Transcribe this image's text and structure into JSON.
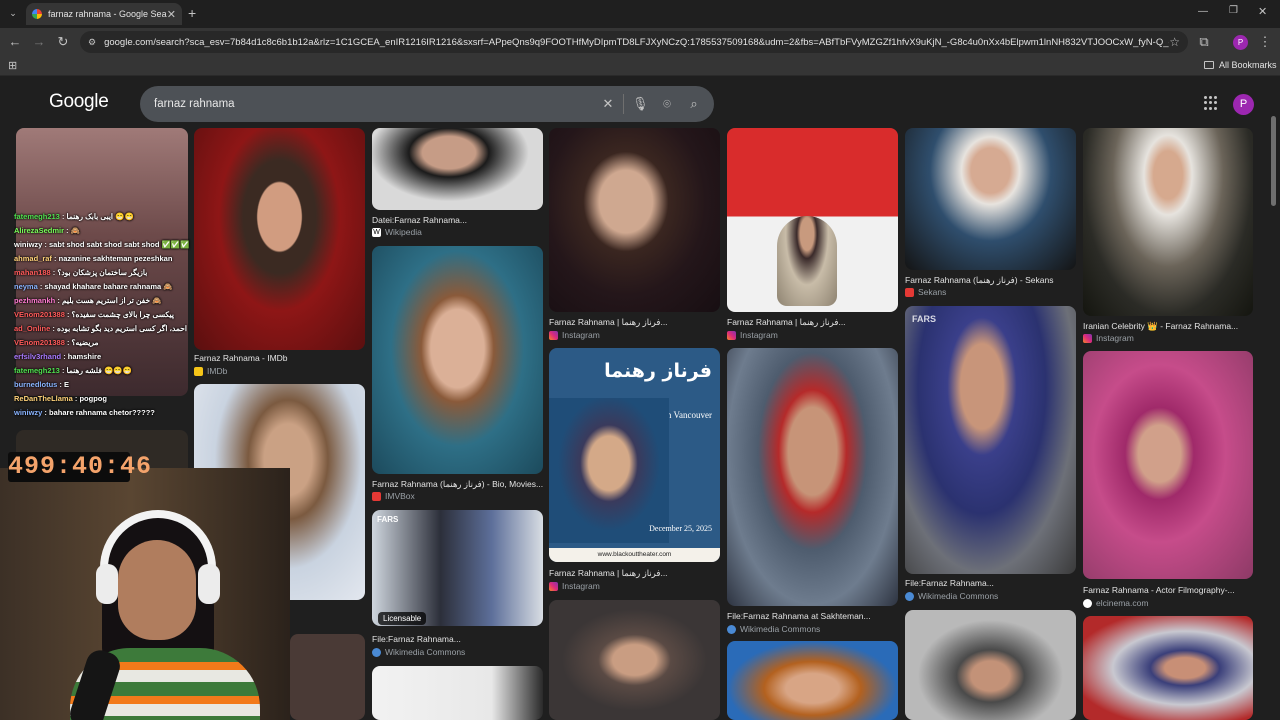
{
  "browser": {
    "tab_title": "farnaz rahnama - Google Search",
    "url": "google.com/search?sca_esv=7b84d1c8c6b1b12a&rlz=1C1GCEA_enIR1216IR1216&sxsrf=APpeQns9q9FOOTHfMyDIpmTD8LFJXyNCzQ:1785537509168&udm=2&fbs=ABfTbFVyMZGZf1hfvX9uKjN_-G8c4u0nXx4bElpwm1lnNH832VTJOOCxW_fyN-Q_ezyf8gl...",
    "bookmarks_label": "All Bookmarks",
    "profile_initial": "P"
  },
  "google": {
    "logo": "Google",
    "query": "farnaz rahnama",
    "avatar_initial": "P"
  },
  "results": [
    {
      "caption": "Datei:Farnaz Rahnama...",
      "source": "Wikipedia"
    },
    {
      "caption": "Farnaz Rahnama | فرناز رهنما...",
      "source": "Instagram"
    },
    {
      "caption": "Farnaz Rahnama | فرناز رهنما...",
      "source": "Instagram"
    },
    {
      "caption": "Farnaz Rahnama (فرناز رهنما) - Sekans",
      "source": "Sekans"
    },
    {
      "caption": "Iranian Celebrity 👑 - Farnaz Rahnama...",
      "source": "Instagram"
    },
    {
      "caption": "Farnaz Rahnama - IMDb",
      "source": "IMDb"
    },
    {
      "caption": "Farnaz Rahnama (فرناز رهنما) - Bio, Movies...",
      "source": "IMVBox"
    },
    {
      "caption": "Farnaz Rahnama | فرناز رهنما...",
      "source": "Instagram"
    },
    {
      "caption": "File:Farnaz Rahnama at Sakhteman...",
      "source": "Wikimedia Commons"
    },
    {
      "caption": "File:Farnaz Rahnama...",
      "source": "Wikimedia Commons"
    },
    {
      "caption": "Farnaz Rahnama - Actor Filmography-...",
      "source": "elcinema.com"
    },
    {
      "caption": "File:Farnaz Rahnama...",
      "source": "Wikimedia Commons"
    }
  ],
  "badges": {
    "licensable": "Licensable",
    "fars": "FARS"
  },
  "poster": {
    "title": "فرناز رهنما",
    "location": "North Vancouver",
    "date": "December 25, 2025",
    "site": "www.blackouttheater.com"
  },
  "stream": {
    "timer": "499:40:46",
    "chat": [
      {
        "user": "fatemegh213",
        "msg": "ایبی بابک رهنما 😁😁"
      },
      {
        "user": "AlirezaSedmir",
        "msg": "🙈"
      },
      {
        "user": "winiwzy",
        "msg": "sabt shod sabt shod sabt shod ✅✅✅"
      },
      {
        "user": "ahmad_raf",
        "msg": "nazanine sakhteman pezeshkan"
      },
      {
        "user": "mahan188",
        "msg": "بازیگر ساختمان پزشکان بود؟"
      },
      {
        "user": "neyma",
        "msg": "shayad khahare bahare rahnama 🙈"
      },
      {
        "user": "pezhmankh",
        "msg": "خفن تر از استریم هست بلیم 🙈"
      },
      {
        "user": "VEnom201388",
        "msg": "پیکسی چرا بالای چشمت سفیده؟"
      },
      {
        "user": "ad_Online",
        "msg": "احمد، اگر کسی استریم دید بگو تشابه بوده"
      },
      {
        "user": "VEnom201388",
        "msg": "مریضیه؟"
      },
      {
        "user": "erfsilv3rhand",
        "msg": "hamshire"
      },
      {
        "user": "fatemegh213",
        "msg": "فلشه رهنما 😁😁😁"
      },
      {
        "user": "burnedlotus",
        "msg": "E"
      },
      {
        "user": "ReDanTheLlama",
        "msg": "pogpog"
      },
      {
        "user": "winiwzy",
        "msg": "bahare rahnama chetor?????"
      }
    ]
  }
}
